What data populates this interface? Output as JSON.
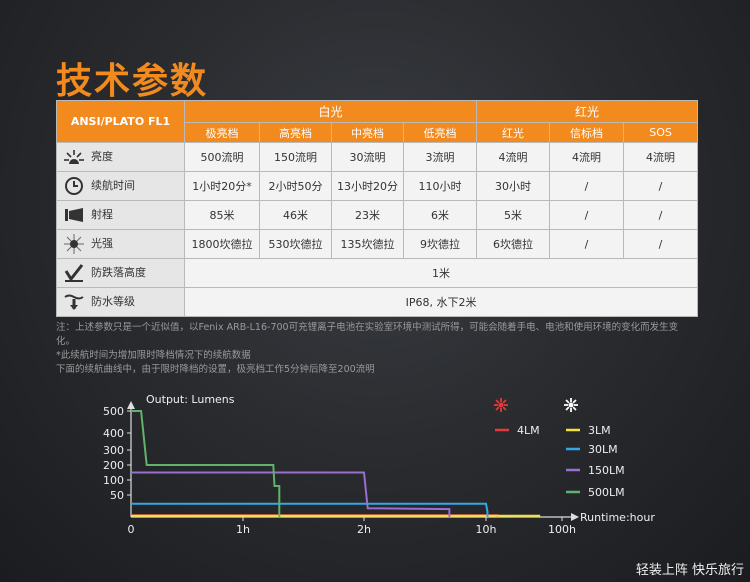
{
  "title": "技术参数",
  "table": {
    "corner": "ANSI/PLATO FL1",
    "groups": {
      "white": "白光",
      "red": "红光"
    },
    "modes": [
      "极亮档",
      "高亮档",
      "中亮档",
      "低亮档",
      "红光",
      "信标档",
      "SOS"
    ],
    "rows": [
      {
        "icon": "brightness-icon",
        "label": "亮度",
        "values": [
          "500流明",
          "150流明",
          "30流明",
          "3流明",
          "4流明",
          "4流明",
          "4流明"
        ]
      },
      {
        "icon": "clock-icon",
        "label": "续航时间",
        "values": [
          "1小时20分*",
          "2小时50分",
          "13小时20分",
          "110小时",
          "30小时",
          "/",
          "/"
        ]
      },
      {
        "icon": "beam-distance-icon",
        "label": "射程",
        "values": [
          "85米",
          "46米",
          "23米",
          "6米",
          "5米",
          "/",
          "/"
        ]
      },
      {
        "icon": "intensity-icon",
        "label": "光强",
        "values": [
          "1800坎德拉",
          "530坎德拉",
          "135坎德拉",
          "9坎德拉",
          "6坎德拉",
          "/",
          "/"
        ]
      },
      {
        "icon": "impact-resistance-icon",
        "label": "防跌落高度",
        "span_value": "1米"
      },
      {
        "icon": "waterproof-icon",
        "label": "防水等级",
        "span_value": "IP68, 水下2米"
      }
    ]
  },
  "notes": {
    "line1": "注：上述参数只是一个近似值，以Fenix ARB-L16-700可充锂离子电池在实验室环境中测试所得，可能会随着手电、电池和使用环境的变化而发生变化。",
    "line2": "*此续航时间为增加限时降档情况下的续航数据",
    "line3": "下面的续航曲线中，由于限时降档的设置，极亮档工作5分钟后降至200流明"
  },
  "chart_data": {
    "type": "line",
    "title": "Output: Lumens",
    "xlabel": "Runtime:hour",
    "x_ticks": [
      "0",
      "1h",
      "2h",
      "10h",
      "100h"
    ],
    "y_ticks": [
      500,
      400,
      300,
      200,
      100,
      50
    ],
    "legend_headers": [
      "red-light-icon",
      "white-light-icon"
    ],
    "series": [
      {
        "name": "4LM",
        "color": "#e53935",
        "points": [
          [
            0,
            4
          ],
          [
            3.15,
            4
          ],
          [
            3.15,
            0
          ]
        ]
      },
      {
        "name": "3LM",
        "color": "#f4e23a",
        "points": [
          [
            0,
            3
          ],
          [
            3.7,
            3
          ],
          [
            3.7,
            0
          ]
        ]
      },
      {
        "name": "30LM",
        "color": "#34a8e6",
        "points": [
          [
            0,
            30
          ],
          [
            3.0,
            30
          ],
          [
            3.02,
            12
          ],
          [
            3.02,
            0
          ]
        ]
      },
      {
        "name": "150LM",
        "color": "#9b6fd1",
        "points": [
          [
            0,
            150
          ],
          [
            2.0,
            150
          ],
          [
            2.03,
            20
          ],
          [
            2.7,
            18
          ],
          [
            2.7,
            0
          ]
        ]
      },
      {
        "name": "500LM",
        "color": "#5fb36a",
        "points": [
          [
            0,
            500
          ],
          [
            0.09,
            500
          ],
          [
            0.14,
            200
          ],
          [
            1.25,
            200
          ],
          [
            1.26,
            80
          ],
          [
            1.3,
            80
          ],
          [
            1.3,
            0
          ]
        ]
      }
    ]
  },
  "footer": "轻装上阵 快乐旅行"
}
